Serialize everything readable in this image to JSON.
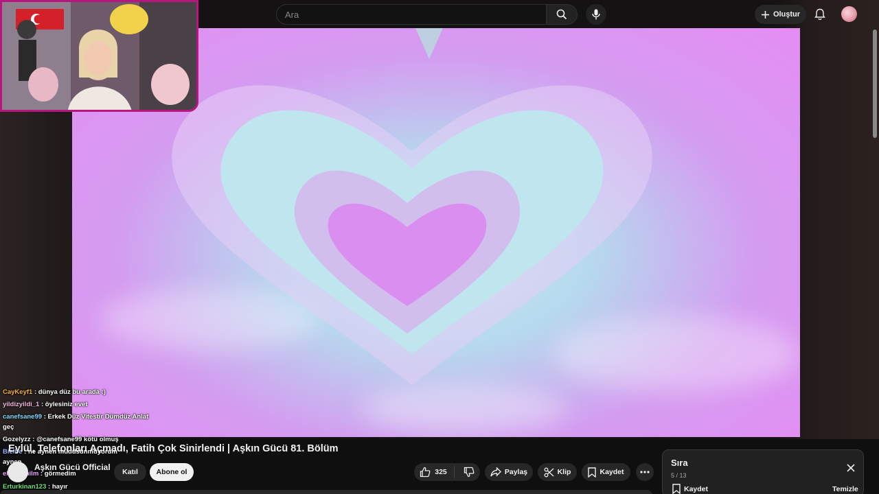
{
  "search": {
    "placeholder": "Ara"
  },
  "header": {
    "create_label": "Oluştur"
  },
  "video": {
    "title": "Eylül, Telefonları Açmadı, Fatih Çok Sinirlendi | Aşkın Gücü 81. Bölüm",
    "channel": "Aşkın Gücü Official",
    "join_label": "Katıl",
    "subscribe_label": "Abone ol",
    "likes": "325",
    "share_label": "Paylaş",
    "clip_label": "Klip",
    "save_label": "Kaydet"
  },
  "chat": [
    {
      "user": "CayKeyf1",
      "user_color": "#f6b13c",
      "message": ": dünya düz bu arada :)"
    },
    {
      "user": "yildizyildi_1",
      "user_color": "#f4b9e6",
      "message": ": öylesiniz evet"
    },
    {
      "user": "canefsane99",
      "user_color": "#7fd9ff",
      "message": ": Erkek Düz Vitestir Dümdüz Anlat"
    },
    {
      "user": "",
      "user_color": "#ffffff",
      "message": "geç"
    },
    {
      "user": "Gozelyzz",
      "user_color": "#ffffff",
      "message": ": @canefsane99 kötü olmuş"
    },
    {
      "user": "Bielbe",
      "user_color": "#9ab2ff",
      "message": ": ne aynen müdüsünmüyorum"
    },
    {
      "user": "",
      "user_color": "#ffffff",
      "message": "aynen"
    },
    {
      "user": "eheshanilm",
      "user_color": "#e8a6ff",
      "message": ": görmedim"
    },
    {
      "user": "Erturkinan123",
      "user_color": "#6ee07a",
      "message": ": hayır"
    }
  ],
  "queue": {
    "title": "Sıra",
    "count": "5 / 13",
    "save_label": "Kaydet",
    "clear_label": "Temizle"
  },
  "colors": {
    "webcam_border": "#b8157e",
    "subscribe_bg": "#f1f1f1",
    "pill_bg": "#272727"
  }
}
